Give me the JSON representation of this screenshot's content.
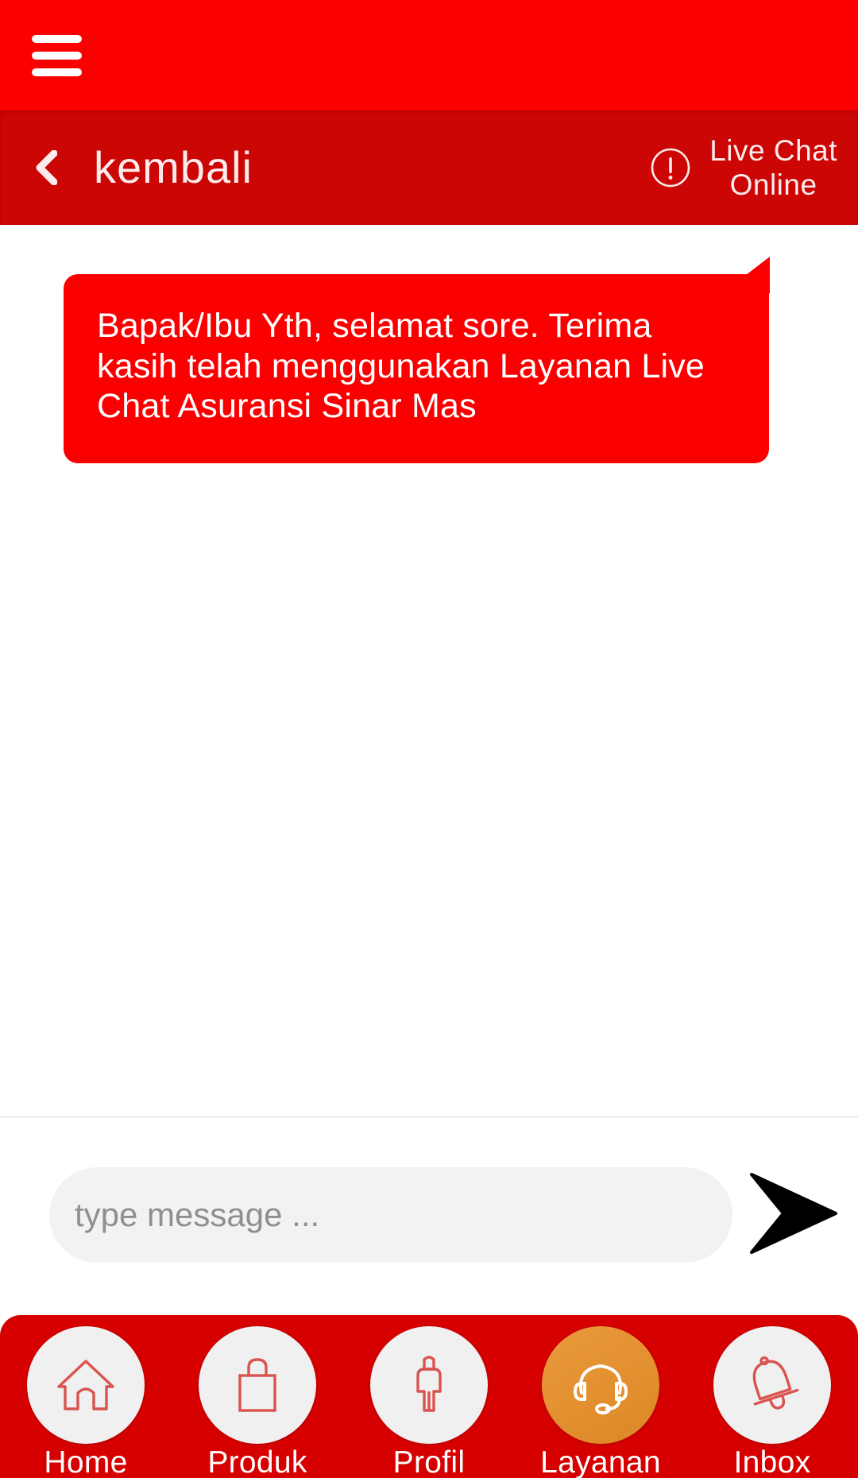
{
  "app": {
    "brand_color": "#FB0000",
    "header_color": "#CC0505",
    "nav_color": "#D60000",
    "active_color": "#E2902F",
    "menu_icon": "hamburger-menu-icon"
  },
  "header": {
    "back_icon": "chevron-left-icon",
    "back_label": "kembali",
    "alert_icon": "exclamation-circle-icon",
    "status_line1": "Live Chat",
    "status_line2": "Online"
  },
  "chat": {
    "messages": [
      {
        "sender": "agent",
        "text": "Bapak/Ibu Yth, selamat sore. Terima kasih telah menggunakan Layanan Live Chat Asuransi Sinar Mas"
      }
    ]
  },
  "composer": {
    "placeholder": "type message ...",
    "value": "",
    "send_icon": "send-arrow-icon"
  },
  "bottom_nav": {
    "items": [
      {
        "label": "Home",
        "icon": "home-icon",
        "active": false
      },
      {
        "label": "Produk",
        "icon": "shopping-bag-icon",
        "active": false
      },
      {
        "label": "Profil",
        "icon": "person-icon",
        "active": false
      },
      {
        "label": "Layanan",
        "icon": "headset-icon",
        "active": true
      },
      {
        "label": "Inbox",
        "icon": "bell-icon",
        "active": false
      }
    ]
  }
}
